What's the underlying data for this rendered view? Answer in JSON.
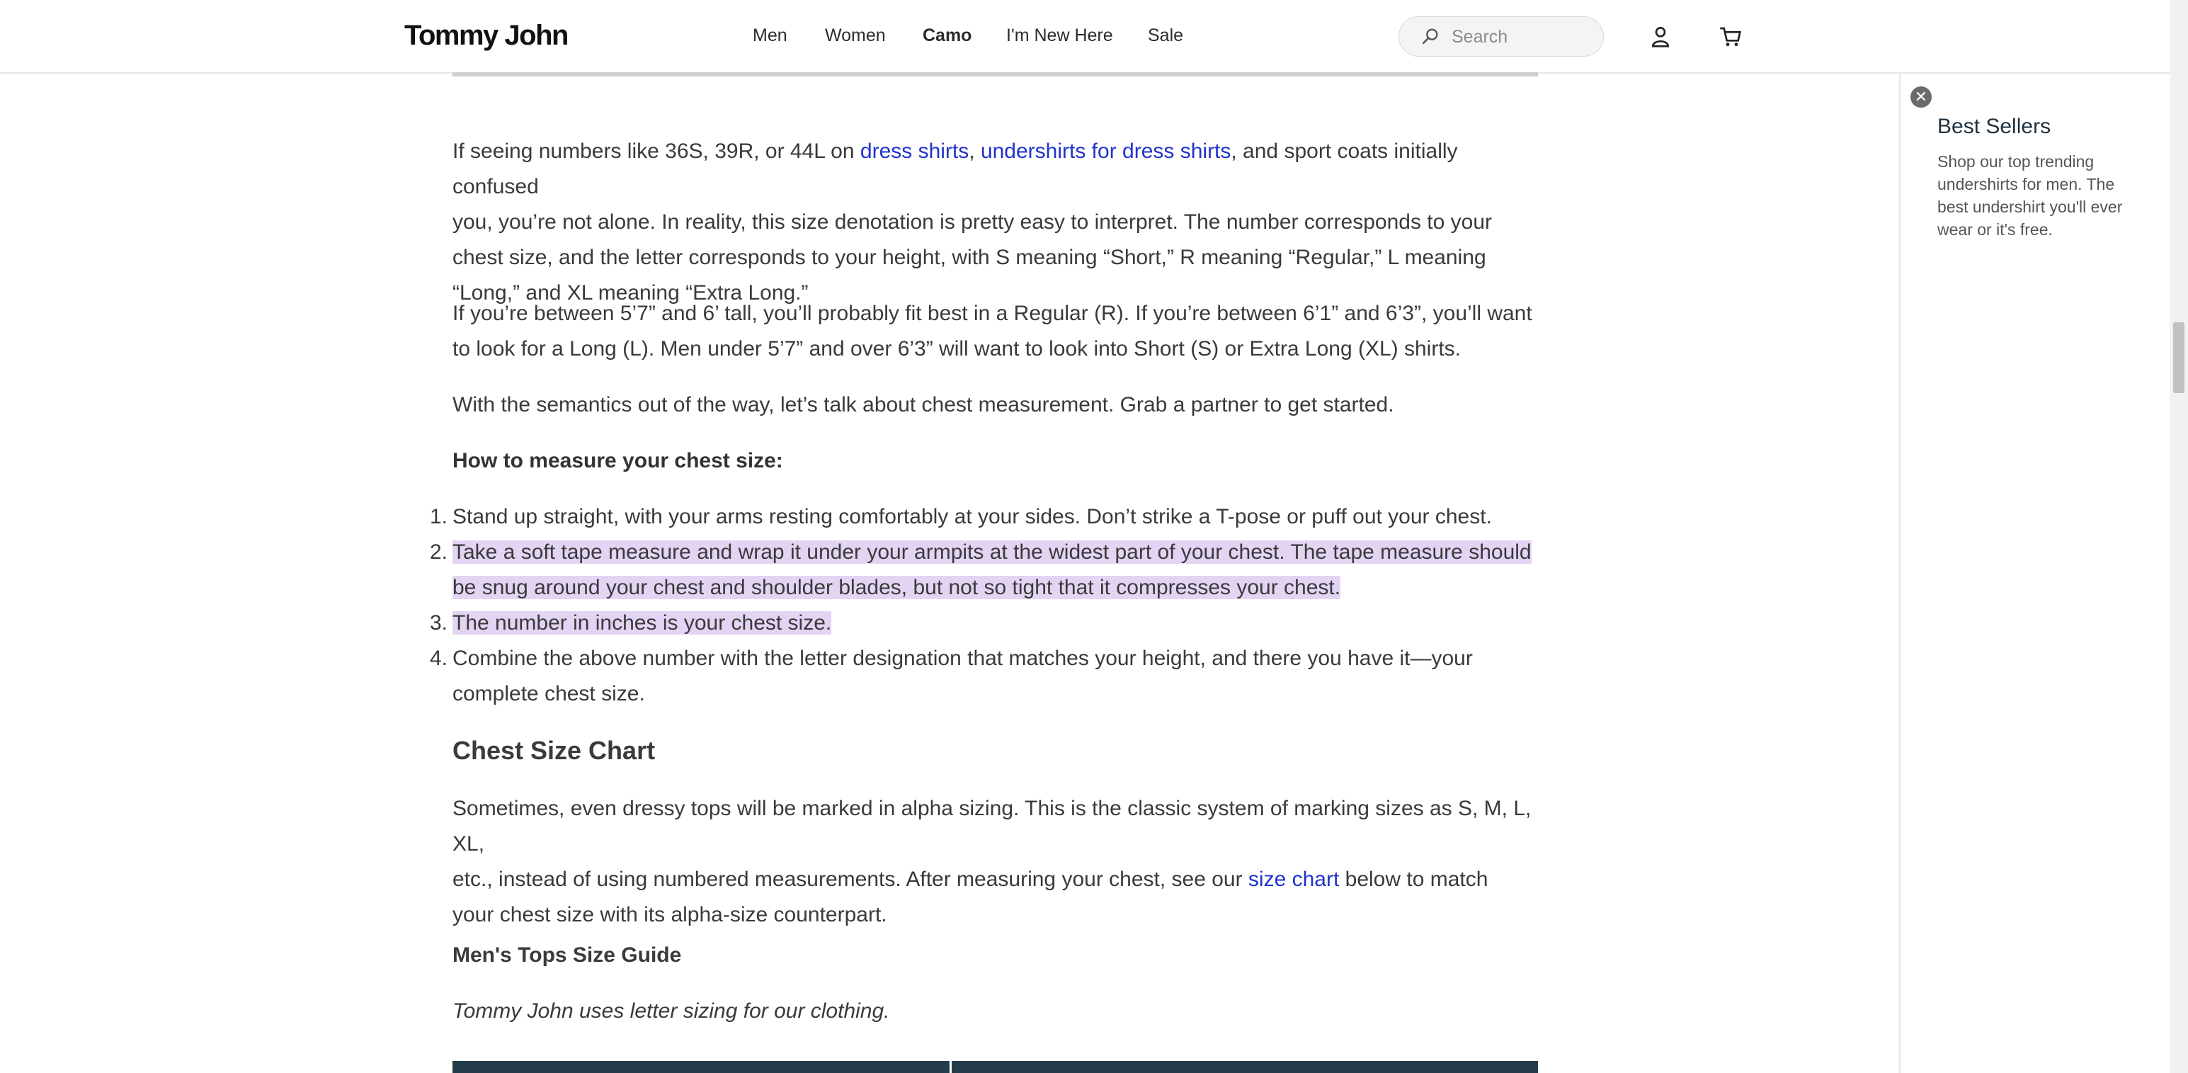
{
  "header": {
    "logo": "Tommy John",
    "nav": [
      "Men",
      "Women",
      "Camo",
      "I'm New Here",
      "Sale"
    ],
    "active_nav": "Camo",
    "search_placeholder": "Search"
  },
  "article": {
    "p1": {
      "pre": "If seeing numbers like 36S, 39R, or 44L on ",
      "link1": "dress shirts",
      "sep": ", ",
      "link2": "undershirts for dress shirts",
      "line1_tail": ", and sport coats initially confused",
      "line2": "you, you’re not alone. In reality, this size denotation is pretty easy to interpret. The number corresponds to your",
      "line3": "chest size, and the letter corresponds to your height, with S meaning “Short,” R meaning “Regular,” L meaning",
      "line4": "“Long,” and XL meaning “Extra Long.”"
    },
    "p2": {
      "line1": "If you’re between 5’7” and 6’ tall, you’ll probably fit best in a Regular (R). If you’re between 6’1” and 6’3”, you’ll want",
      "line2": "to look for a Long (L). Men under 5’7” and over 6’3” will want to look into Short (S) or Extra Long (XL) shirts."
    },
    "p3": "With the semantics out of the way, let’s talk about chest measurement. Grab a partner to get started.",
    "how_to_heading": "How to measure your chest size:",
    "steps": [
      {
        "num": "1.",
        "lines": [
          "Stand up straight, with your arms resting comfortably at your sides. Don’t strike a T-pose or puff out your chest."
        ]
      },
      {
        "num": "2.",
        "lines": [
          "Take a soft tape measure and wrap it under your armpits at the widest part of your chest. The tape measure should",
          "be snug around your chest and shoulder blades, but not so tight that it compresses your chest."
        ]
      },
      {
        "num": "3.",
        "lines": [
          "The number in inches is your chest size."
        ]
      },
      {
        "num": "4.",
        "lines": [
          "Combine the above number with the letter designation that matches your height, and there you have it—your",
          "complete chest size."
        ]
      }
    ],
    "chart_heading": "Chest Size Chart",
    "p4": {
      "line1": "Sometimes, even dressy tops will be marked in alpha sizing. This is the classic system of marking sizes as S, M, L, XL,",
      "line2_pre": "etc., instead of using numbered measurements. After measuring your chest, see our ",
      "link": "size chart",
      "line2_post": " below to match",
      "line3": "your chest size with its alpha-size counterpart."
    },
    "guide_heading": "Men's Tops Size Guide",
    "guide_sub": "Tommy John uses letter sizing for our clothing."
  },
  "sidebar": {
    "title": "Best Sellers",
    "text": "Shop our top trending undershirts for men. The best undershirt you'll ever wear or it's free."
  },
  "colors": {
    "link": "#2233cc",
    "highlight": "#e4d4f4",
    "table_header": "#243b4a"
  }
}
